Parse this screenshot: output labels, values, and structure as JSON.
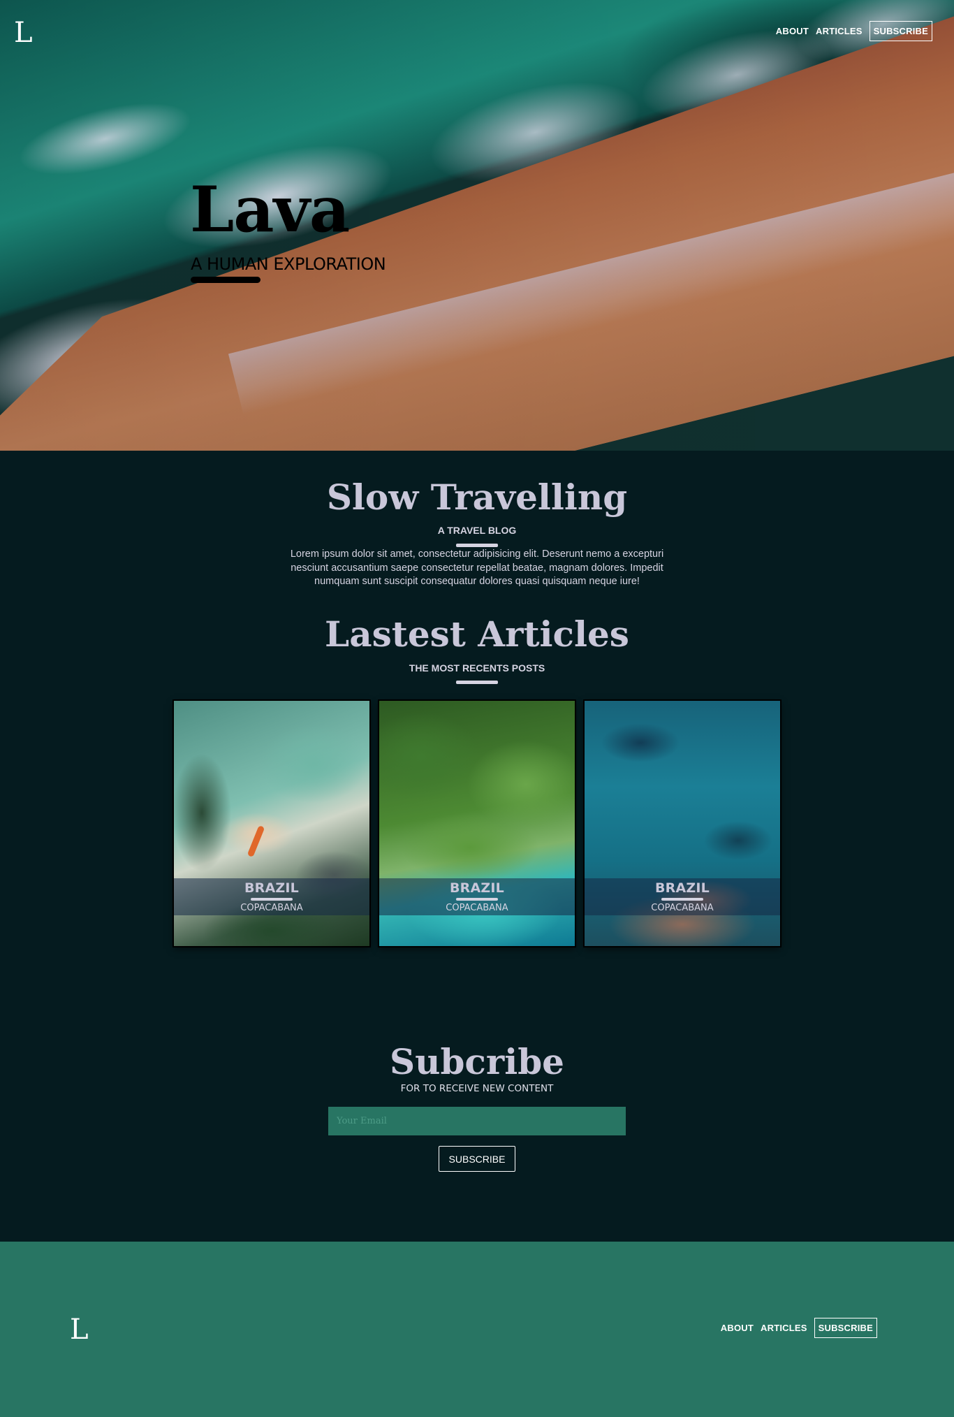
{
  "header": {
    "logo": "L",
    "nav": [
      "ABOUT",
      "ARTICLES",
      "SUBSCRIBE"
    ]
  },
  "hero": {
    "title": "Lava",
    "subtitle": "A HUMAN EXPLORATION"
  },
  "intro": {
    "title": "Slow Travelling",
    "kicker": "A TRAVEL BLOG",
    "text": "Lorem ipsum dolor sit amet, consectetur adipisicing elit. Deserunt nemo a excepturi nesciunt accusantium saepe consectetur repellat beatae, magnam dolores. Impedit numquam sunt suscipit consequatur dolores quasi quisquam neque iure!"
  },
  "articles": {
    "title": "Lastest Articles",
    "kicker": "THE MOST RECENTS POSTS",
    "cards": [
      {
        "title": "BRAZIL",
        "subtitle": "COPACABANA"
      },
      {
        "title": "BRAZIL",
        "subtitle": "COPACABANA"
      },
      {
        "title": "BRAZIL",
        "subtitle": "COPACABANA"
      }
    ]
  },
  "subscribe": {
    "title": "Subcribe",
    "caption": "FOR TO RECEIVE NEW CONTENT",
    "email_placeholder": "Your Email",
    "email_value": "",
    "button": "SUBSCRIBE"
  },
  "footer": {
    "logo": "L",
    "nav": [
      "ABOUT",
      "ARTICLES",
      "SUBSCRIBE"
    ]
  },
  "colors": {
    "page_background": "#051b1f",
    "accent_green": "#287563",
    "heading_text": "#c9c7d9"
  }
}
